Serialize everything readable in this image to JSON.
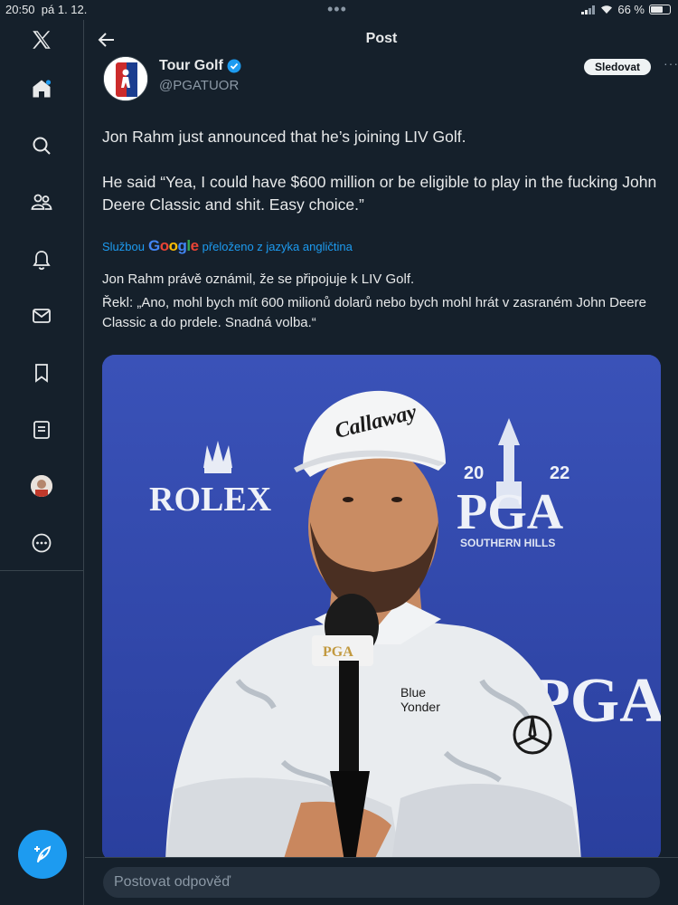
{
  "status_bar": {
    "time": "20:50",
    "date": "pá 1. 12.",
    "battery": "66 %",
    "battery_level": 0.66
  },
  "sidebar": {
    "items": [
      {
        "icon": "x-logo-icon"
      },
      {
        "icon": "home-icon"
      },
      {
        "icon": "search-icon"
      },
      {
        "icon": "communities-icon"
      },
      {
        "icon": "notifications-icon"
      },
      {
        "icon": "messages-icon"
      },
      {
        "icon": "bookmarks-icon"
      },
      {
        "icon": "lists-icon"
      },
      {
        "icon": "profile-avatar"
      },
      {
        "icon": "more-icon"
      }
    ],
    "compose_icon": "compose-feather-icon"
  },
  "header": {
    "title": "Post",
    "back_icon": "arrow-left-icon"
  },
  "post": {
    "author_name": "Tour Golf",
    "author_handle": "@PGATUOR",
    "verified": true,
    "follow_label": "Sledovat",
    "more_label": "···",
    "text_lines": [
      "Jon Rahm just announced that he’s joining LIV Golf.",
      "He said “Yea, I could have $600 million or be eligible to play in the fucking John Deere Classic and shit. Easy choice.”"
    ],
    "translation": {
      "prefix": "Službou",
      "brand": "Google",
      "suffix": "přeloženo z jazyka angličtina",
      "lines": [
        "Jon Rahm právě oznámil, že se připojuje k LIV Golf.",
        "Řekl: „Ano, mohl bych mít 600 milionů dolarů nebo bych mohl hrát v zasraném John Deere Classic a do prdele. Snadná volba.“"
      ]
    },
    "media": {
      "backdrop_left": "ROLEX",
      "backdrop_year_left": "20",
      "backdrop_year_right": "22",
      "backdrop_right": "PGA",
      "backdrop_sub": "SOUTHERN HILLS",
      "cap_text": "Callaway",
      "mic_text": "PGA",
      "shirt_text_1": "Blue",
      "shirt_text_2": "Yonder"
    }
  },
  "reply": {
    "placeholder": "Postovat odpověď"
  },
  "colors": {
    "bg": "#15202b",
    "accent": "#1d9bf0",
    "text": "#e7e9ea",
    "muted": "#8b98a5"
  }
}
